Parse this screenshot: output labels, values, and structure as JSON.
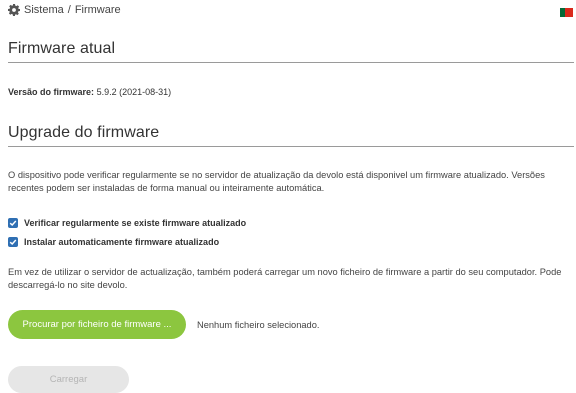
{
  "breadcrumb": {
    "icon": "gear-icon",
    "section": "Sistema",
    "separator": "/",
    "page": "Firmware"
  },
  "language_flag": {
    "icon": "portugal-flag-icon",
    "colors": [
      "#046a38",
      "#da291c"
    ]
  },
  "current_firmware": {
    "title": "Firmware atual",
    "version_label": "Versão do firmware:",
    "version_value": "5.9.2 (2021-08-31)"
  },
  "upgrade": {
    "title": "Upgrade do firmware",
    "intro": "O dispositivo pode verificar regularmente se no servidor de atualização da devolo está disponivel um firmware atualizado. Versões recentes podem ser instaladas de forma manual ou inteiramente automática.",
    "options": [
      {
        "label": "Verificar regularmente se existe firmware atualizado",
        "checked": true
      },
      {
        "label": "Instalar automaticamente firmware atualizado",
        "checked": true
      }
    ],
    "manual_text": "Em vez de utilizar o servidor de actualização, também poderá carregar um novo ficheiro de firmware a partir do seu computador. Pode descarregá-lo no site devolo.",
    "browse_button": "Procurar por ficheiro de firmware ...",
    "no_file_text": "Nenhum ficheiro selecionado.",
    "upload_button": "Carregar",
    "upload_enabled": false
  },
  "colors": {
    "accent_green": "#8cc63f",
    "checkbox_blue": "#2f6fb3",
    "disabled_gray": "#e6e6e6"
  }
}
